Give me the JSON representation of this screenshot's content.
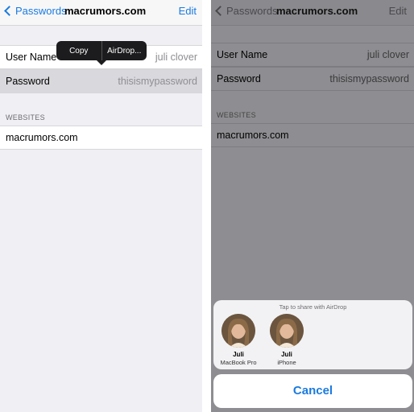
{
  "left": {
    "nav": {
      "back_label": "Passwords",
      "title": "macrumors.com",
      "edit_label": "Edit"
    },
    "tooltip": {
      "copy_label": "Copy",
      "airdrop_label": "AirDrop..."
    },
    "fields": [
      {
        "label": "User Name",
        "value": "juli clover"
      },
      {
        "label": "Password",
        "value": "thisismypassword"
      }
    ],
    "websites_header": "WEBSITES",
    "website": "macrumors.com"
  },
  "right": {
    "nav": {
      "back_label": "Passwords",
      "title": "macrumors.com",
      "edit_label": "Edit"
    },
    "fields": [
      {
        "label": "User Name",
        "value": "juli clover"
      },
      {
        "label": "Password",
        "value": "thisismypassword"
      }
    ],
    "websites_header": "WEBSITES",
    "website": "macrumors.com",
    "share_sheet": {
      "hint": "Tap to share with AirDrop",
      "people": [
        {
          "name": "Juli",
          "device": "MacBook Pro"
        },
        {
          "name": "Juli",
          "device": "iPhone"
        }
      ],
      "cancel_label": "Cancel"
    }
  },
  "colors": {
    "accent": "#1a7ae0",
    "dim_overlay": "#8e8e92"
  }
}
